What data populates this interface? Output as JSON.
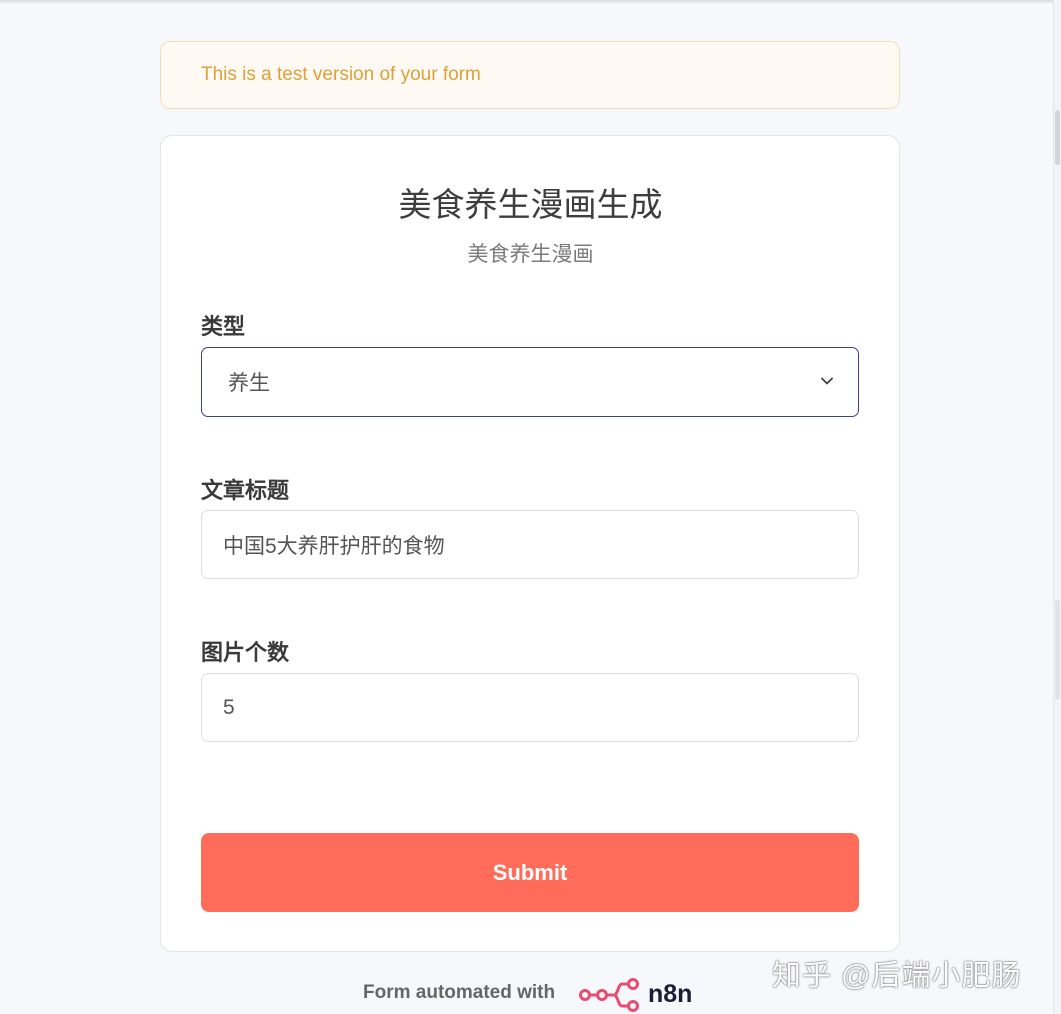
{
  "banner": {
    "text": "This is a test version of your form"
  },
  "form": {
    "title": "美食养生漫画生成",
    "subtitle": "美食养生漫画",
    "fields": [
      {
        "label": "类型",
        "type": "select",
        "value": "养生"
      },
      {
        "label": "文章标题",
        "type": "text",
        "value": "中国5大养肝护肝的食物"
      },
      {
        "label": "图片个数",
        "type": "number",
        "value": "5"
      }
    ],
    "submit_label": "Submit"
  },
  "footer": {
    "text": "Form automated with",
    "brand": "n8n"
  },
  "watermark": "知乎 @后端小肥肠",
  "colors": {
    "accent": "#ff6d5a",
    "banner_text": "#dda13a",
    "focus_border": "#3d3f8f",
    "brand_pink": "#ea4b71"
  }
}
